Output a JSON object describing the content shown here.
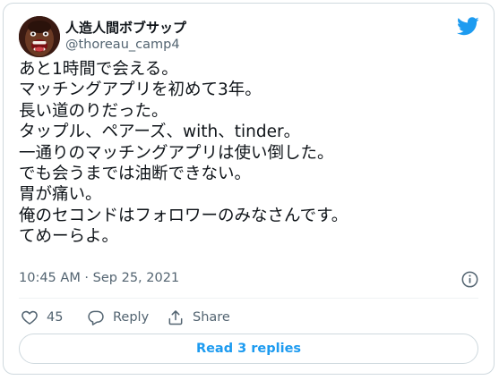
{
  "author": {
    "display_name": "人造人間ボブサップ",
    "handle": "@thoreau_camp4",
    "avatar_icon": "profile-photo"
  },
  "tweet": {
    "lines": [
      "あと1時間で会える。",
      "マッチングアプリを初めて3年。",
      "長い道のりだった。",
      "タップル、ペアーズ、with、tinder。",
      "一通りのマッチングアプリは使い倒した。",
      "でも会うまでは油断できない。",
      "胃が痛い。",
      "俺のセコンドはフォロワーのみなさんです。",
      "てめーらよ。"
    ],
    "timestamp": "10:45 AM · Sep 25, 2021"
  },
  "actions": {
    "like_count": "45",
    "reply_label": "Reply",
    "share_label": "Share"
  },
  "replies_button_label": "Read 3 replies",
  "icons": {
    "brand": "twitter-bird-icon",
    "info": "info-icon",
    "like": "heart-icon",
    "reply": "speech-bubble-icon",
    "share": "share-upload-icon"
  },
  "colors": {
    "text": "#0f1419",
    "secondary": "#536471",
    "accent": "#1d9bf0",
    "border": "#cfd9de"
  }
}
